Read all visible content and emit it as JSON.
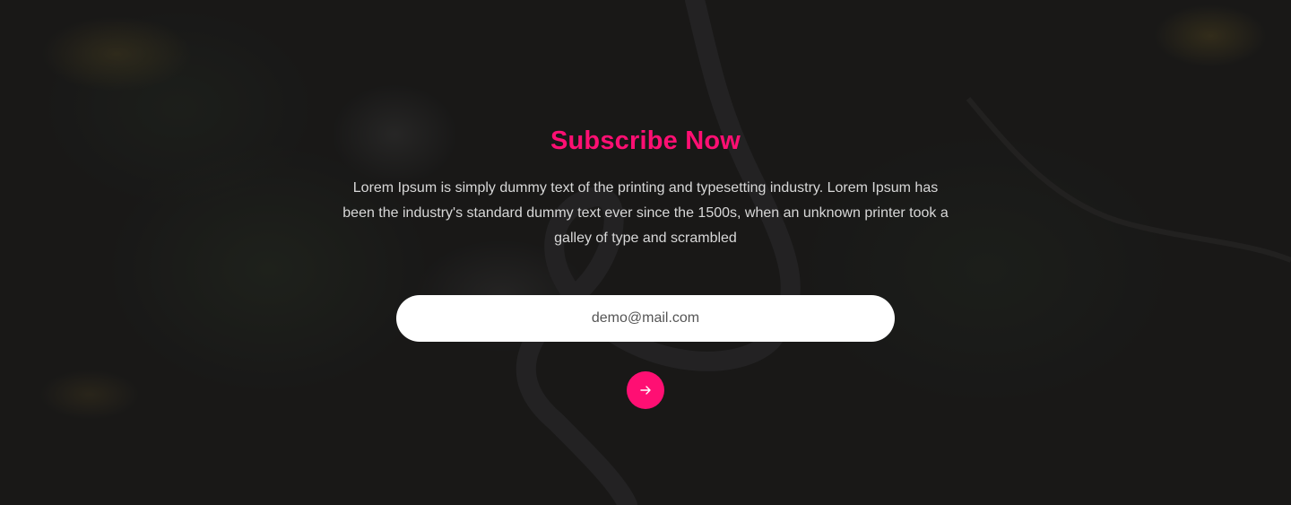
{
  "subscribe": {
    "title": "Subscribe Now",
    "description": "Lorem Ipsum is simply dummy text of the printing and typesetting industry. Lorem Ipsum has been the industry's standard dummy text ever since the 1500s, when an unknown printer took a galley of type and scrambled",
    "email_placeholder": "demo@mail.com",
    "submit_icon": "arrow-right-icon"
  },
  "colors": {
    "accent": "#ff0f73",
    "background": "#1c1b1a",
    "text_light": "#d8d8d8",
    "input_bg": "#ffffff"
  }
}
